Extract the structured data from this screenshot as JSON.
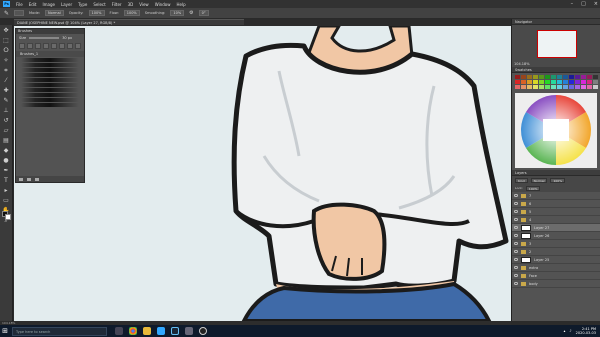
{
  "app": {
    "logo": "Ps"
  },
  "menu": [
    "File",
    "Edit",
    "Image",
    "Layer",
    "Type",
    "Select",
    "Filter",
    "3D",
    "View",
    "Window",
    "Help"
  ],
  "options": {
    "mode_label": "Mode:",
    "mode": "Normal",
    "opacity_label": "Opacity:",
    "opacity": "100%",
    "flow_label": "Flow:",
    "flow": "100%",
    "smoothing_label": "Smoothing:",
    "smoothing": "10%",
    "angle": "0°"
  },
  "document_tab": "DIANE JOSEPHINE NEW.psd @ 104% (Layer 27, RGB/8) *",
  "brush_panel": {
    "title": "Brushes",
    "size_label": "Size",
    "size_value": "30 px",
    "folder": "Brushes_1",
    "strokes": 10
  },
  "right_panels": {
    "navigator_tab": "Navigator",
    "zoom": "104.18%",
    "swatches_tab": "Swatches",
    "layers_tab": "Layers"
  },
  "layers": {
    "kind_label": "Kind",
    "blend": "Normal",
    "opacity": "100%",
    "lock_label": "Lock:",
    "fill": "100%",
    "items": [
      {
        "name": "7",
        "type": "folder"
      },
      {
        "name": "6",
        "type": "folder"
      },
      {
        "name": "5",
        "type": "folder"
      },
      {
        "name": "4",
        "type": "folder"
      },
      {
        "name": "Layer 27",
        "type": "layer",
        "selected": true
      },
      {
        "name": "Layer 26",
        "type": "layer"
      },
      {
        "name": "3",
        "type": "folder"
      },
      {
        "name": "2",
        "type": "folder"
      },
      {
        "name": "Layer 25",
        "type": "layer"
      },
      {
        "name": "extra",
        "type": "folder"
      },
      {
        "name": "Face",
        "type": "folder"
      },
      {
        "name": "body",
        "type": "folder"
      }
    ]
  },
  "status": {
    "zoom": "104.18%"
  },
  "taskbar": {
    "search_placeholder": "Type here to search",
    "time": "2:41 PM",
    "date": "2020-03-03"
  },
  "colors": {
    "ps_blue": "#31a8ff",
    "panel": "#535353",
    "canvas": "#e3ecee",
    "shirt": "#eef0f1",
    "jeans": "#3f6aa8"
  }
}
